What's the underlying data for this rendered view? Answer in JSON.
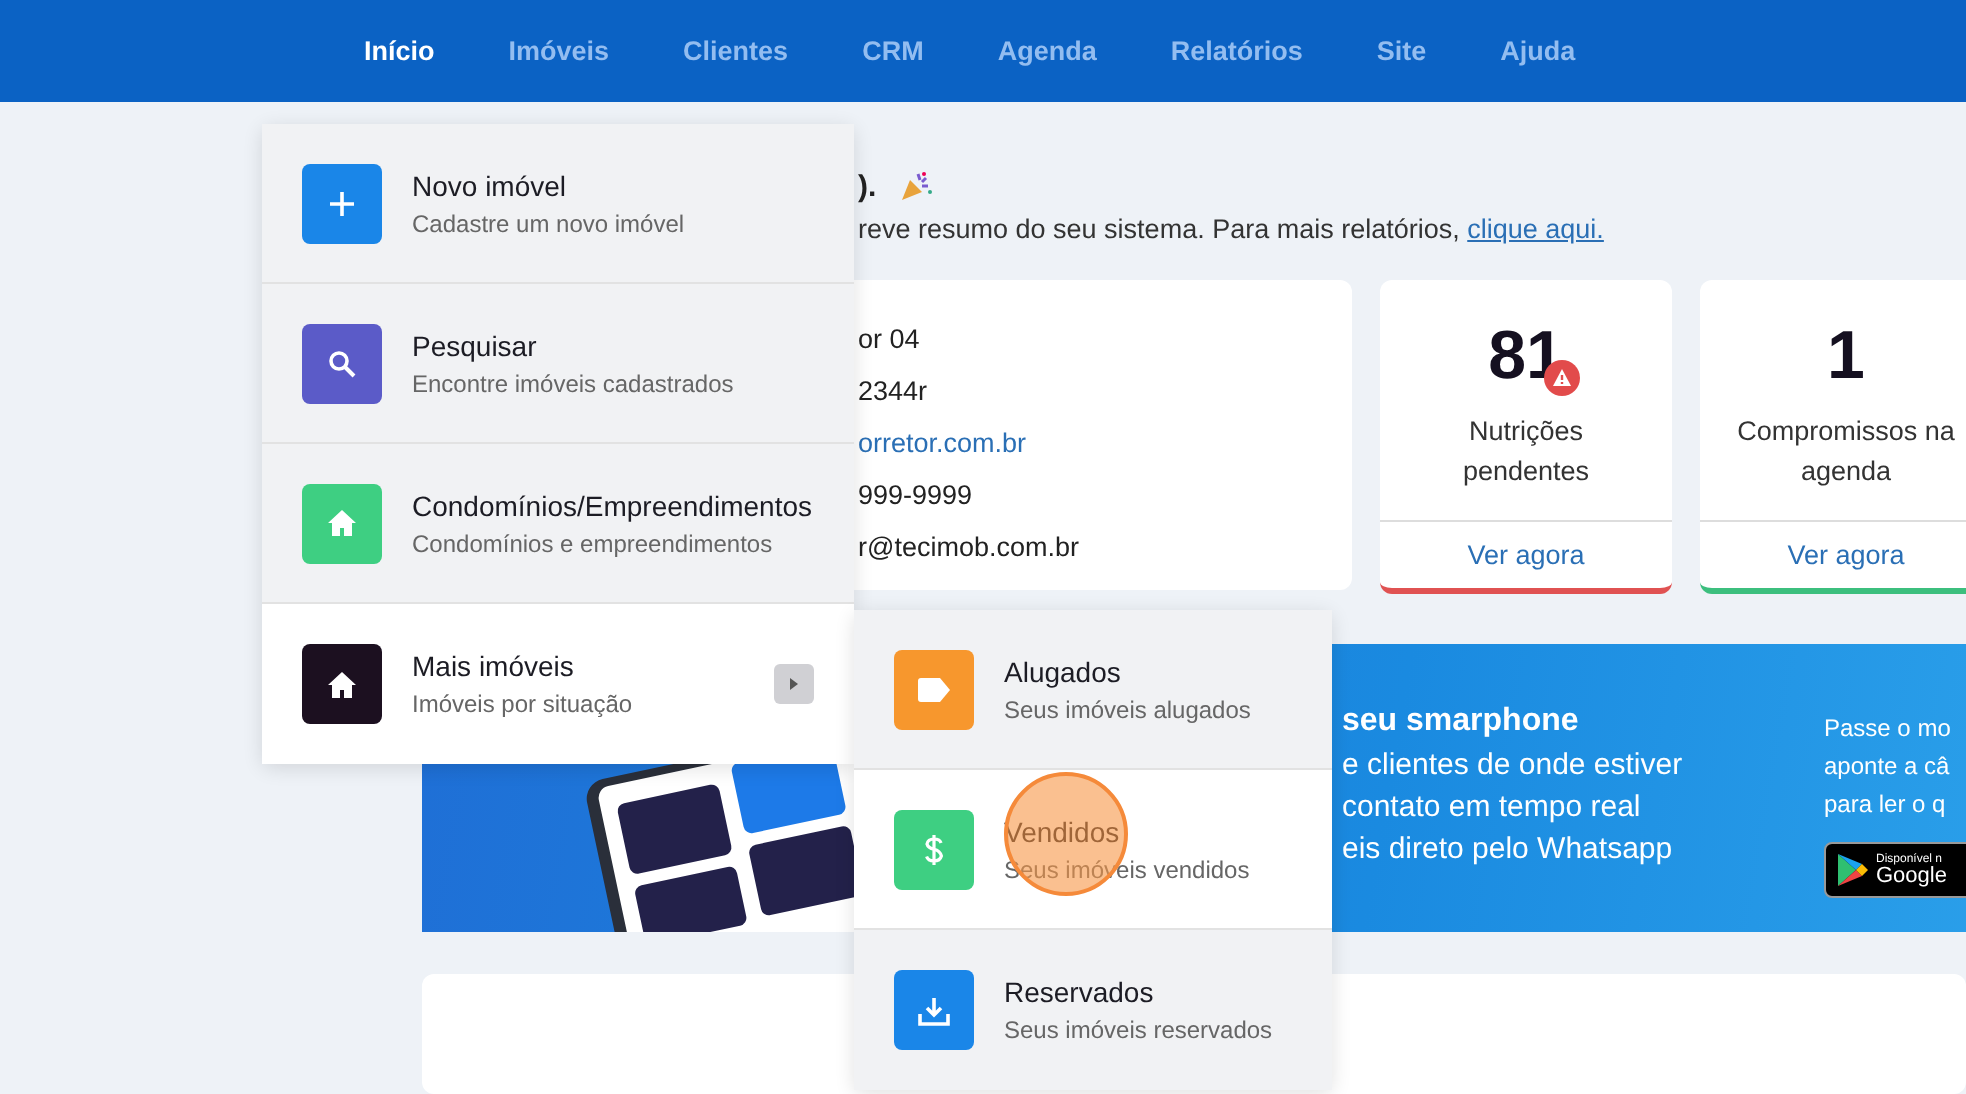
{
  "nav": [
    {
      "label": "Início",
      "selected": true
    },
    {
      "label": "Imóveis",
      "selected": false
    },
    {
      "label": "Clientes",
      "selected": false
    },
    {
      "label": "CRM",
      "selected": false
    },
    {
      "label": "Agenda",
      "selected": false
    },
    {
      "label": "Relatórios",
      "selected": false
    },
    {
      "label": "Site",
      "selected": false
    },
    {
      "label": "Ajuda",
      "selected": false
    }
  ],
  "greeting": ").",
  "summary": "reve resumo do seu sistema. Para mais relatórios,",
  "summary_link": "clique aqui.",
  "profile_lines": [
    {
      "text": "or 04",
      "kind": "plain"
    },
    {
      "text": "2344r",
      "kind": "plain"
    },
    {
      "text": "orretor.com.br",
      "kind": "link"
    },
    {
      "text": "999-9999",
      "kind": "plain"
    },
    {
      "text": "r@tecimob.com.br",
      "kind": "plain"
    }
  ],
  "stats": [
    {
      "value": "81",
      "alert": true,
      "label": "Nutrições pendentes",
      "action": "Ver agora",
      "color": "#e05252"
    },
    {
      "value": "1",
      "alert": false,
      "label": "Compromissos na agenda",
      "action": "Ver agora",
      "color": "#3cbf7e"
    }
  ],
  "banner": {
    "title": "seu smarphone",
    "lines": [
      "e clientes de onde estiver",
      "contato em tempo real",
      "eis direto pelo Whatsapp"
    ],
    "side_lines": [
      "Passe o mo",
      "aponte a câ",
      "para ler o q"
    ],
    "store_badge": {
      "small": "Disponível n",
      "name": "Google"
    }
  },
  "menu": [
    {
      "title": "Novo imóvel",
      "subtitle": "Cadastre um novo imóvel",
      "kind": "plus",
      "color": "#1a86e8",
      "selected": false
    },
    {
      "title": "Pesquisar",
      "subtitle": "Encontre imóveis cadastrados",
      "kind": "search",
      "color": "#5b5bc8",
      "selected": false
    },
    {
      "title": "Condomínios/Empreendimentos",
      "subtitle": "Condomínios e empreendimentos",
      "kind": "home",
      "color": "#3ecf82",
      "selected": false
    },
    {
      "title": "Mais imóveis",
      "subtitle": "Imóveis por situação",
      "kind": "home",
      "color": "#1c1020",
      "submenu": true,
      "selected": true
    }
  ],
  "submenu": [
    {
      "title": "Alugados",
      "subtitle": "Seus imóveis alugados",
      "kind": "tag",
      "color": "#f7972d",
      "selected": false
    },
    {
      "title": "Vendidos",
      "subtitle": "Seus imóveis vendidos",
      "kind": "dollar",
      "color": "#3ecf82",
      "selected": true
    },
    {
      "title": "Reservados",
      "subtitle": "Seus imóveis reservados",
      "kind": "download",
      "color": "#1a86e8",
      "selected": false
    }
  ]
}
